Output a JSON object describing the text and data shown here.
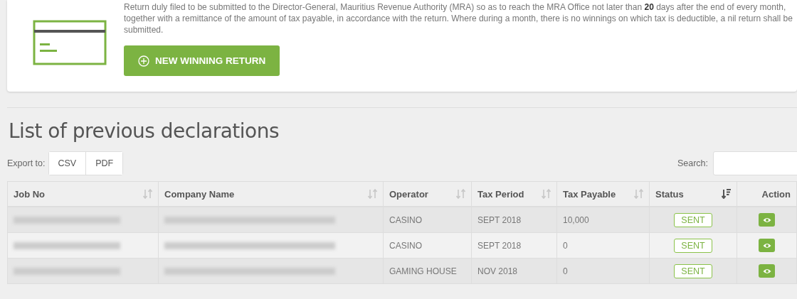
{
  "intro": {
    "text": "Return duly filed to be submitted to the Director-General, Mauritius Revenue Authority (MRA) so as to reach the MRA Office not later than **20** days after the end of every month, together with a remittance of the amount of tax payable, in accordance with the return. Where during a month, there is no winnings on which tax is deductible, a nil return shall be submitted.",
    "button": "NEW WINNING RETURN"
  },
  "heading": "List of previous declarations",
  "export": {
    "label": "Export to:",
    "buttons": [
      "CSV",
      "PDF"
    ]
  },
  "search": {
    "label": "Search:"
  },
  "table": {
    "columns": [
      {
        "label": "Job No",
        "sortable": true,
        "sorted": false
      },
      {
        "label": "Company Name",
        "sortable": true,
        "sorted": false
      },
      {
        "label": "Operator",
        "sortable": true,
        "sorted": false
      },
      {
        "label": "Tax Period",
        "sortable": true,
        "sorted": false
      },
      {
        "label": "Tax Payable",
        "sortable": true,
        "sorted": false
      },
      {
        "label": "Status",
        "sortable": true,
        "sorted": true
      },
      {
        "label": "Action",
        "sortable": false,
        "sorted": false
      }
    ],
    "rows": [
      {
        "job_redacted": true,
        "company_redacted": true,
        "operator": "CASINO",
        "tax_period": "SEPT 2018",
        "tax_payable": "10,000",
        "status": "SENT"
      },
      {
        "job_redacted": true,
        "company_redacted": true,
        "operator": "CASINO",
        "tax_period": "SEPT 2018",
        "tax_payable": "0",
        "status": "SENT"
      },
      {
        "job_redacted": true,
        "company_redacted": true,
        "operator": "GAMING HOUSE",
        "tax_period": "NOV 2018",
        "tax_payable": "0",
        "status": "SENT"
      }
    ]
  }
}
